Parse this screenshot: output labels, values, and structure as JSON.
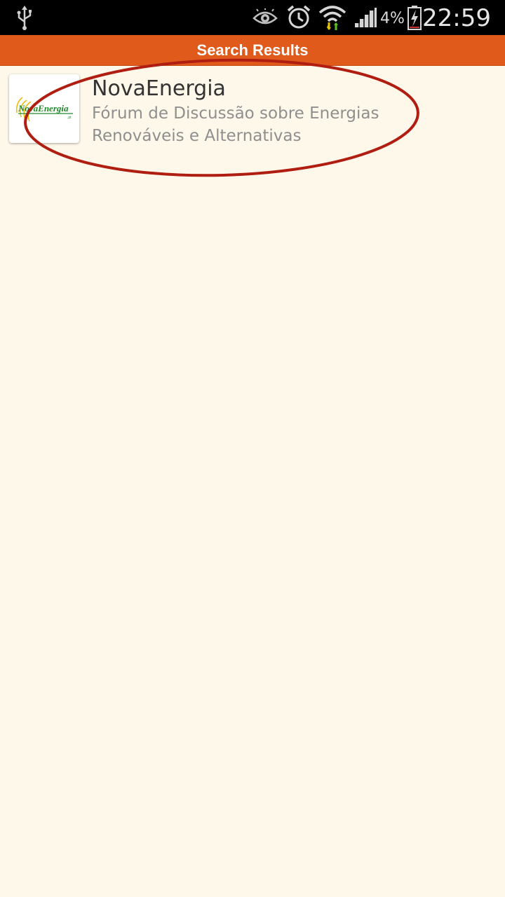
{
  "status_bar": {
    "battery_percent": "4%",
    "time": "22:59",
    "icons": [
      "usb-icon",
      "eye-icon",
      "alarm-icon",
      "wifi-icon",
      "signal-icon",
      "battery-charging-icon"
    ]
  },
  "header": {
    "title": "Search Results"
  },
  "results": [
    {
      "title": "NovaEnergia",
      "description": "Fórum de Discussão sobre Energias Renováveis e Alternativas",
      "logo_text": "NovaEnergia",
      "logo_suffix": ".pt"
    }
  ],
  "colors": {
    "header_bg": "#e05a1c",
    "page_bg": "#fef8ea",
    "annotation": "#b01e12"
  }
}
